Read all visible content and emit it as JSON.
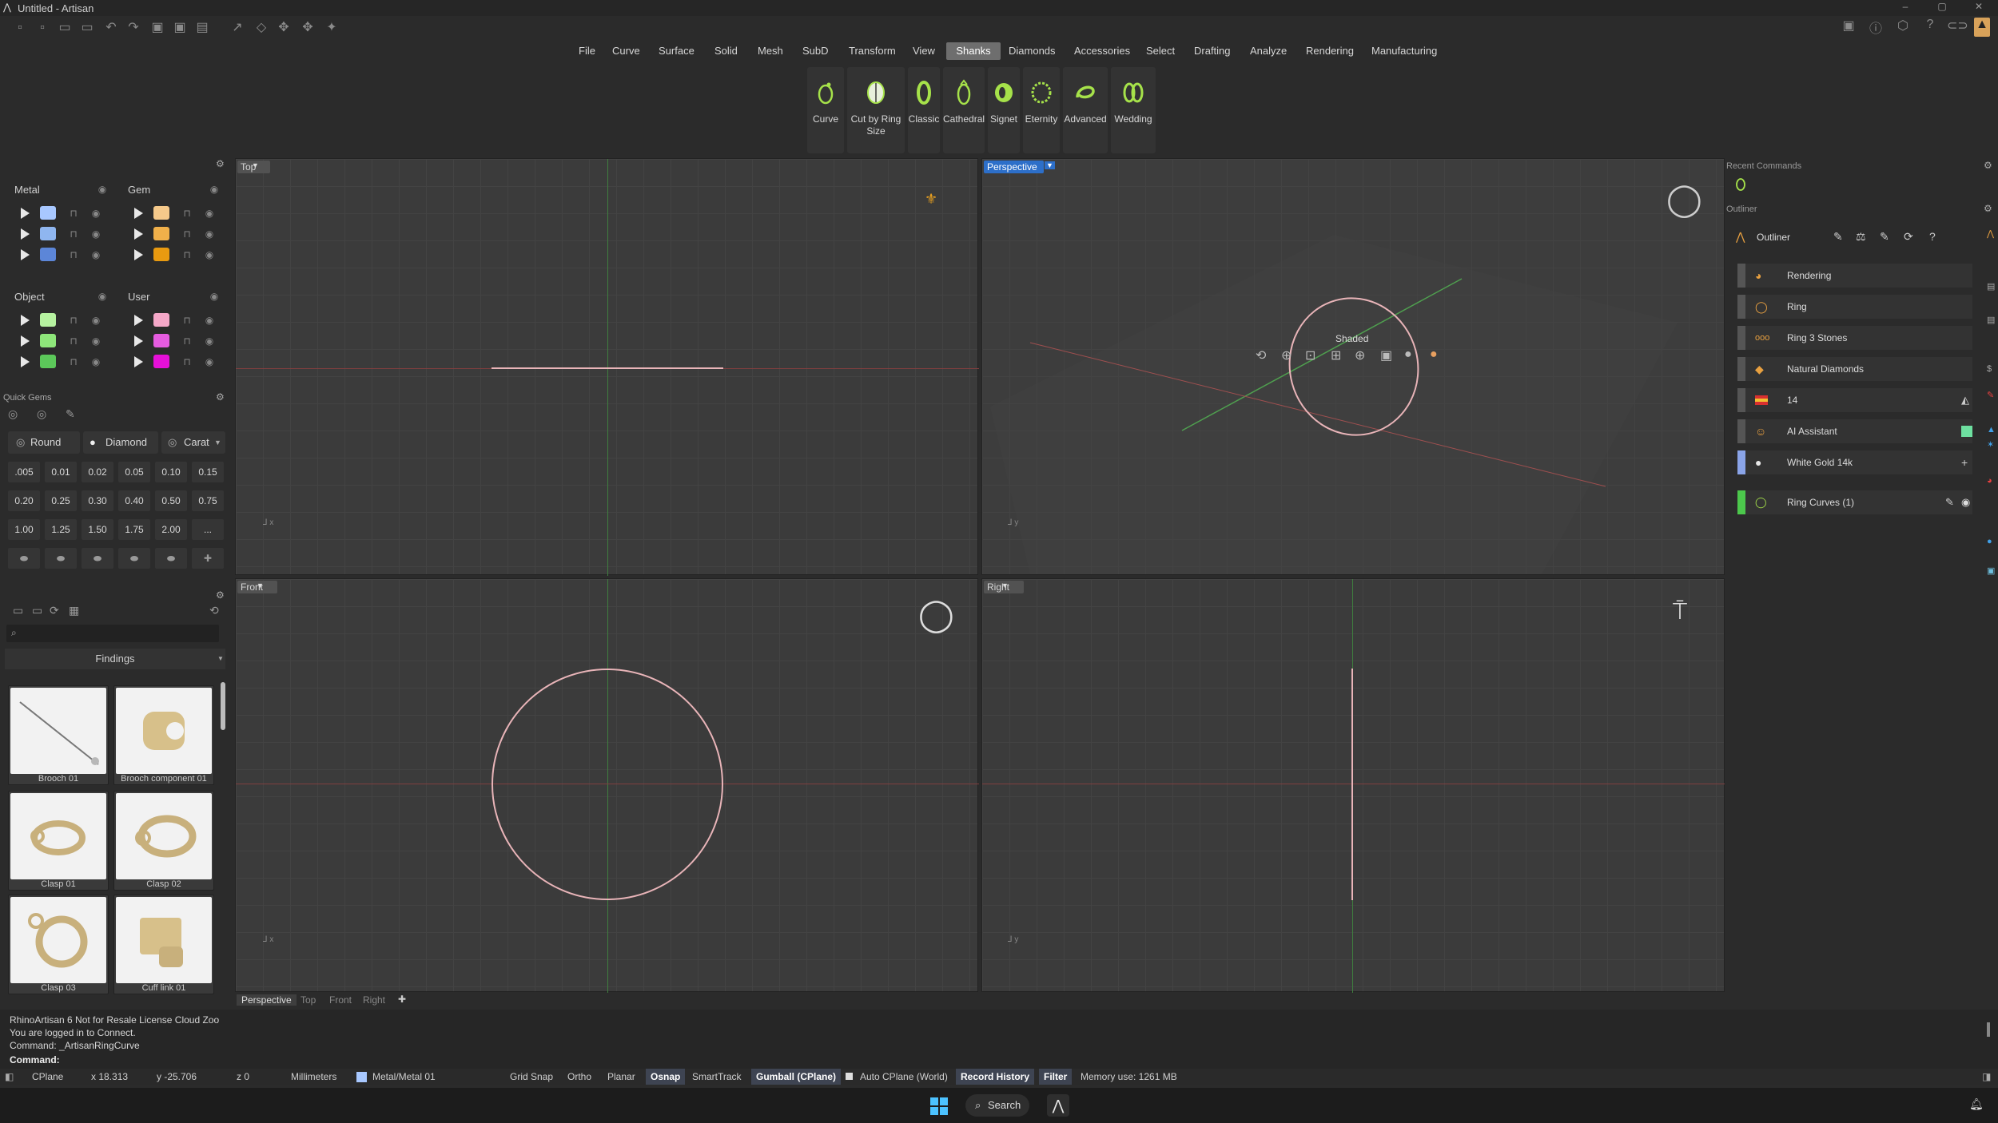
{
  "window": {
    "title": "Untitled - Artisan"
  },
  "menu": [
    "File",
    "Curve",
    "Surface",
    "Solid",
    "Mesh",
    "SubD",
    "Transform",
    "View",
    "Shanks",
    "Diamonds",
    "Accessories",
    "Select",
    "Drafting",
    "Analyze",
    "Rendering",
    "Manufacturing"
  ],
  "active_menu": "Shanks",
  "ribbon": [
    {
      "label": "Curve",
      "icon": "ring-curve-icon"
    },
    {
      "label": "Cut by Ring Size",
      "icon": "cut-ring-icon"
    },
    {
      "label": "Classic",
      "icon": "classic-shank-icon"
    },
    {
      "label": "Cathedral",
      "icon": "cathedral-shank-icon"
    },
    {
      "label": "Signet",
      "icon": "signet-shank-icon"
    },
    {
      "label": "Eternity",
      "icon": "eternity-shank-icon"
    },
    {
      "label": "Advanced",
      "icon": "advanced-shank-icon"
    },
    {
      "label": "Wedding",
      "icon": "wedding-shank-icon"
    }
  ],
  "materials": {
    "metal": {
      "title": "Metal",
      "colors": [
        "#a8c8ff",
        "#8fb6f0",
        "#5c86d8"
      ]
    },
    "gem": {
      "title": "Gem",
      "colors": [
        "#f5c98a",
        "#f0b04a",
        "#e89a10"
      ]
    },
    "object": {
      "title": "Object",
      "colors": [
        "#b6f2a0",
        "#8ee67a",
        "#5cc85a"
      ]
    },
    "user": {
      "title": "User",
      "colors": [
        "#f5a8c8",
        "#e65ce0",
        "#e610d8"
      ]
    }
  },
  "quick_gems": {
    "title": "Quick Gems",
    "shape": "Round",
    "cut": "Diamond",
    "unit": "Carat",
    "sizes": [
      ".005",
      "0.01",
      "0.02",
      "0.05",
      "0.10",
      "0.15",
      "0.20",
      "0.25",
      "0.30",
      "0.40",
      "0.50",
      "0.75",
      "1.00",
      "1.25",
      "1.50",
      "1.75",
      "2.00",
      "..."
    ]
  },
  "library": {
    "category": "Findings",
    "search_placeholder": "",
    "items": [
      "Brooch 01",
      "Brooch component 01",
      "Clasp 01",
      "Clasp 02",
      "Clasp 03",
      "Cuff link 01"
    ]
  },
  "viewports": {
    "top": "Top",
    "perspective": "Perspective",
    "front": "Front",
    "right": "Right",
    "display_mode": "Shaded"
  },
  "viewport_tabs": [
    "Perspective",
    "Top",
    "Front",
    "Right"
  ],
  "right_panel": {
    "recent_commands": "Recent Commands",
    "outliner_section": "Outliner",
    "outliner_title": "Outliner",
    "items": [
      {
        "label": "Rendering",
        "color": "#555555"
      },
      {
        "label": "Ring",
        "color": "#555555"
      },
      {
        "label": "Ring 3 Stones",
        "color": "#555555"
      },
      {
        "label": "Natural Diamonds",
        "color": "#555555"
      },
      {
        "label": "14",
        "color": "#555555"
      },
      {
        "label": "AI Assistant",
        "color": "#555555"
      },
      {
        "label": "White Gold 14k",
        "color": "#8aa4e8"
      }
    ],
    "layer": {
      "label": "Ring Curves (1)",
      "color": "#4cc84c"
    }
  },
  "command": {
    "history": [
      "RhinoArtisan 6 Not for Resale License Cloud Zoo",
      "You are logged in to Connect.",
      "Command: _ArtisanRingCurve"
    ],
    "prompt": "Command:"
  },
  "status": {
    "cplane": "CPlane",
    "x": "x 18.313",
    "y": "y -25.706",
    "z": "z 0",
    "units": "Millimeters",
    "layer": "Metal/Metal 01",
    "grid_snap": "Grid Snap",
    "ortho": "Ortho",
    "planar": "Planar",
    "osnap": "Osnap",
    "smarttrack": "SmartTrack",
    "gumball": "Gumball (CPlane)",
    "auto_cplane": "Auto CPlane (World)",
    "record_history": "Record History",
    "filter": "Filter",
    "memory": "Memory use: 1261 MB"
  },
  "taskbar": {
    "search": "Search"
  }
}
